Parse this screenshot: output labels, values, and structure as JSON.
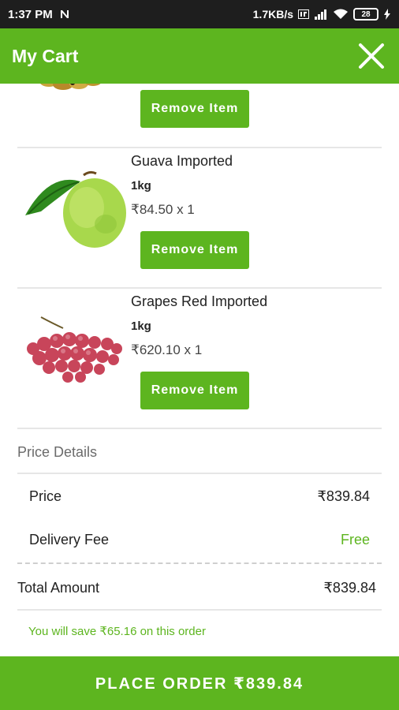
{
  "status_bar": {
    "time": "1:37 PM",
    "net_speed": "1.7KB/s",
    "battery": "28"
  },
  "app_bar": {
    "title": "My Cart"
  },
  "cart": {
    "items": [
      {
        "name": "",
        "qty": "",
        "price": "",
        "remove_label": "Remove Item"
      },
      {
        "name": "Guava Imported",
        "qty": "1kg",
        "price": "₹84.50 x 1",
        "remove_label": "Remove Item"
      },
      {
        "name": "Grapes Red Imported",
        "qty": "1kg",
        "price": "₹620.10 x 1",
        "remove_label": "Remove Item"
      }
    ]
  },
  "price_details": {
    "title": "Price Details",
    "price_label": "Price",
    "price_value": "₹839.84",
    "delivery_label": "Delivery Fee",
    "delivery_value": "Free",
    "total_label": "Total Amount",
    "total_value": "₹839.84",
    "save_note": "You will save ₹65.16 on this order"
  },
  "footer": {
    "place_order_label": "PLACE ORDER ₹839.84"
  },
  "colors": {
    "brand_green": "#5db51f",
    "status_bar": "#1e1e1e"
  }
}
